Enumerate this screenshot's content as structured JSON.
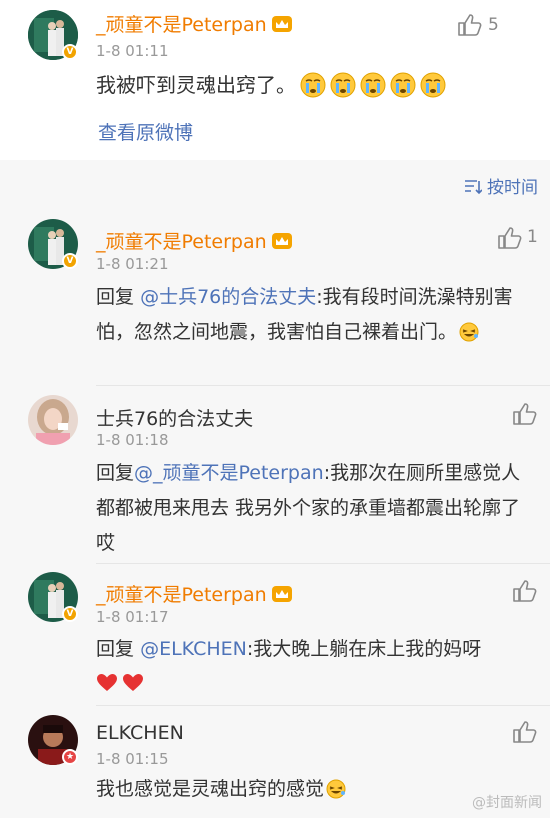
{
  "top_comment": {
    "username": "_顽童不是Peterpan",
    "time": "1-8 01:11",
    "text": "我被吓到灵魂出窍了。",
    "like_count": "5",
    "view_original": "查看原微博"
  },
  "sort_label": "按时间",
  "replies": [
    {
      "username": "_顽童不是Peterpan",
      "time": "1-8 01:21",
      "prefix": "回复",
      "mention": "@士兵76的合法丈夫",
      "text": ":我有段时间洗澡特别害怕，忽然之间地震，我害怕自己裸着出门。",
      "like_count": "1"
    },
    {
      "username": "士兵76的合法丈夫",
      "time": "1-8 01:18",
      "prefix": "回复",
      "mention": "@_顽童不是Peterpan",
      "text": ":我那次在厕所里感觉人都都被甩来甩去 我另外个家的承重墙都震出轮廓了 哎",
      "like_count": ""
    },
    {
      "username": "_顽童不是Peterpan",
      "time": "1-8 01:17",
      "prefix": "回复",
      "mention": "@ELKCHEN",
      "text": ":我大晚上躺在床上我的妈呀",
      "like_count": ""
    },
    {
      "username": "ELKCHEN",
      "time": "1-8 01:15",
      "text": "我也感觉是灵魂出窍的感觉",
      "like_count": ""
    }
  ],
  "watermark": "@封面新闻",
  "colors": {
    "accent_orange": "#f07c00",
    "link_blue": "#4e73b8",
    "heart_red": "#e63232"
  }
}
